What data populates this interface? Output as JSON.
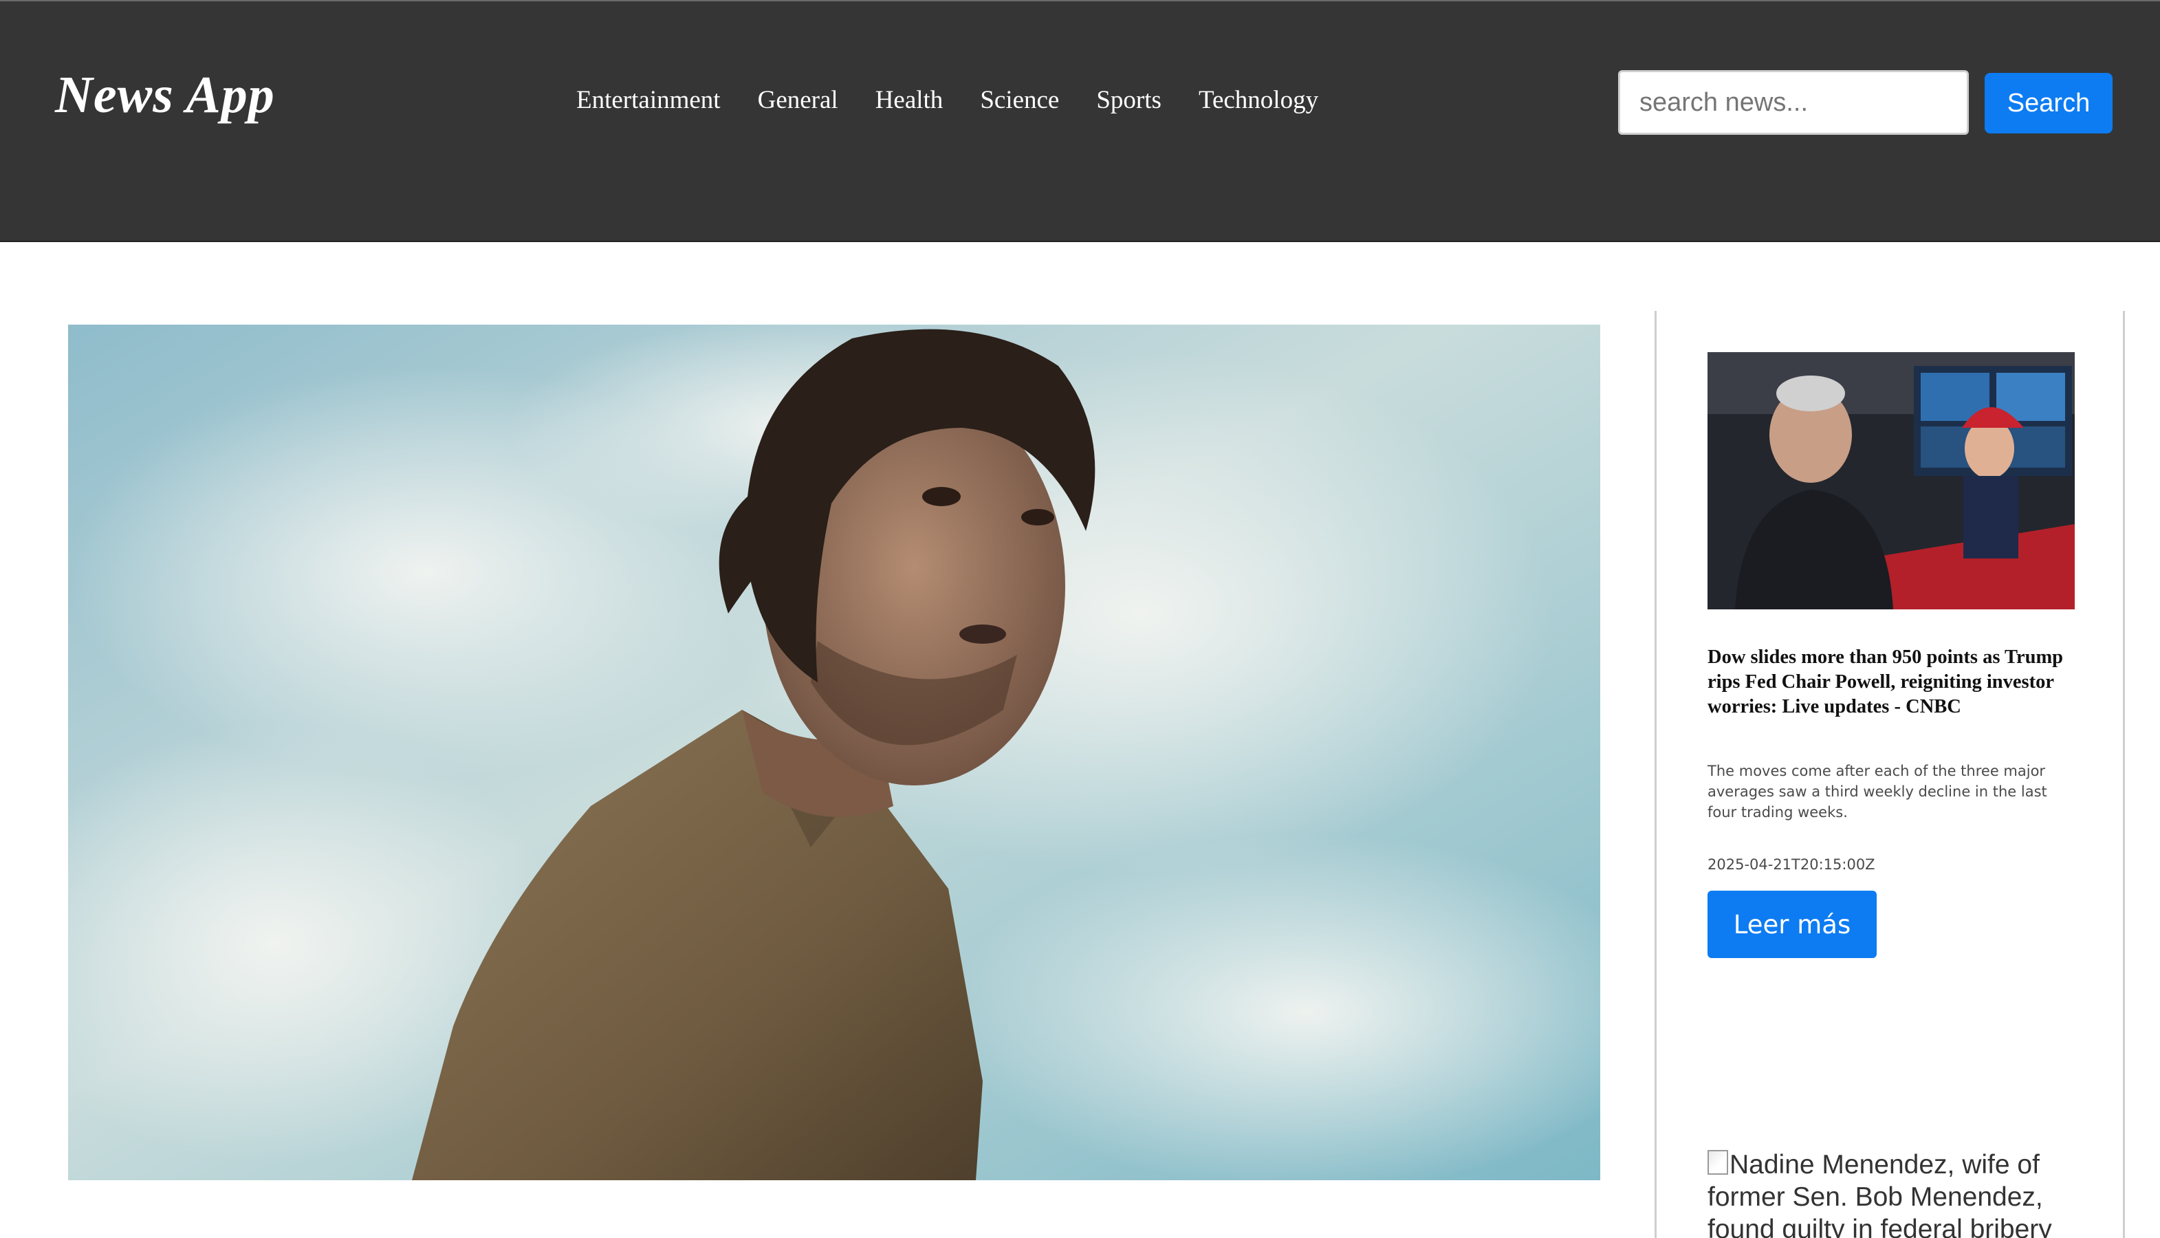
{
  "header": {
    "brand": "News App",
    "nav": [
      "Entertainment",
      "General",
      "Health",
      "Science",
      "Sports",
      "Technology"
    ],
    "search": {
      "placeholder": "search news...",
      "button_label": "Search"
    }
  },
  "sidebar": {
    "cards": [
      {
        "title": "Dow slides more than 950 points as Trump rips Fed Chair Powell, reigniting investor worries: Live updates - CNBC",
        "description": "The moves come after each of the three major averages saw a third weekly decline in the last four trading weeks.",
        "date": "2025-04-21T20:15:00Z",
        "button_label": "Leer más"
      },
      {
        "image_alt": "Nadine Menendez, wife of former Sen. Bob Menendez, found guilty in federal bribery"
      }
    ]
  },
  "colors": {
    "navbar_bg": "#353535",
    "accent": "#0d7cf2",
    "text_dark": "#111111",
    "text_muted": "#4a4a4a"
  }
}
